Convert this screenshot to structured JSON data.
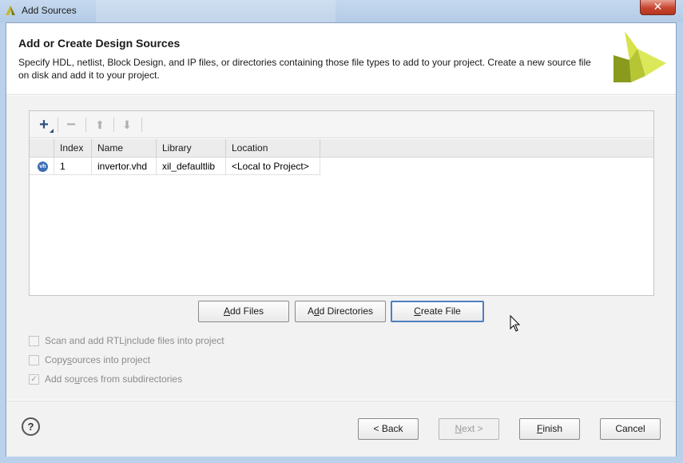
{
  "window": {
    "title": "Add Sources",
    "close_glyph": "✕"
  },
  "header": {
    "title": "Add or Create Design Sources",
    "description": "Specify HDL, netlist, Block Design, and IP files, or directories containing those file types to add to your project. Create a new source file on disk and add it to your project."
  },
  "toolbar": {
    "add": "+",
    "remove": "−",
    "up": "⬆",
    "down": "⬇"
  },
  "table": {
    "columns": [
      "Index",
      "Name",
      "Library",
      "Location"
    ],
    "rows": [
      {
        "icon": "vhdl-file-icon",
        "icon_text": "vh",
        "index": "1",
        "name": "invertor.vhd",
        "library": "xil_defaultlib",
        "location": "<Local to Project>"
      }
    ]
  },
  "buttons": {
    "add_files_u": "A",
    "add_files_rest": "dd Files",
    "add_dirs_pre": "A",
    "add_dirs_u": "d",
    "add_dirs_rest": "d Directories",
    "create_file_u": "C",
    "create_file_rest": "reate File"
  },
  "options": {
    "scan_pre": "Scan and add RTL ",
    "scan_u": "i",
    "scan_rest": "nclude files into project",
    "copy_pre": "Copy ",
    "copy_u": "s",
    "copy_rest": "ources into project",
    "sub_pre": "Add so",
    "sub_u": "u",
    "sub_rest": "rces from subdirectories",
    "checkmark": "✓"
  },
  "footer": {
    "help": "?",
    "back": "< Back",
    "next_u": "N",
    "next_rest": "ext >",
    "finish_u": "F",
    "finish_rest": "inish",
    "cancel": "Cancel"
  },
  "colors": {
    "accent": "#4d7fc0",
    "logo_light": "#d6e34a",
    "logo_dark": "#8a9a1c"
  }
}
